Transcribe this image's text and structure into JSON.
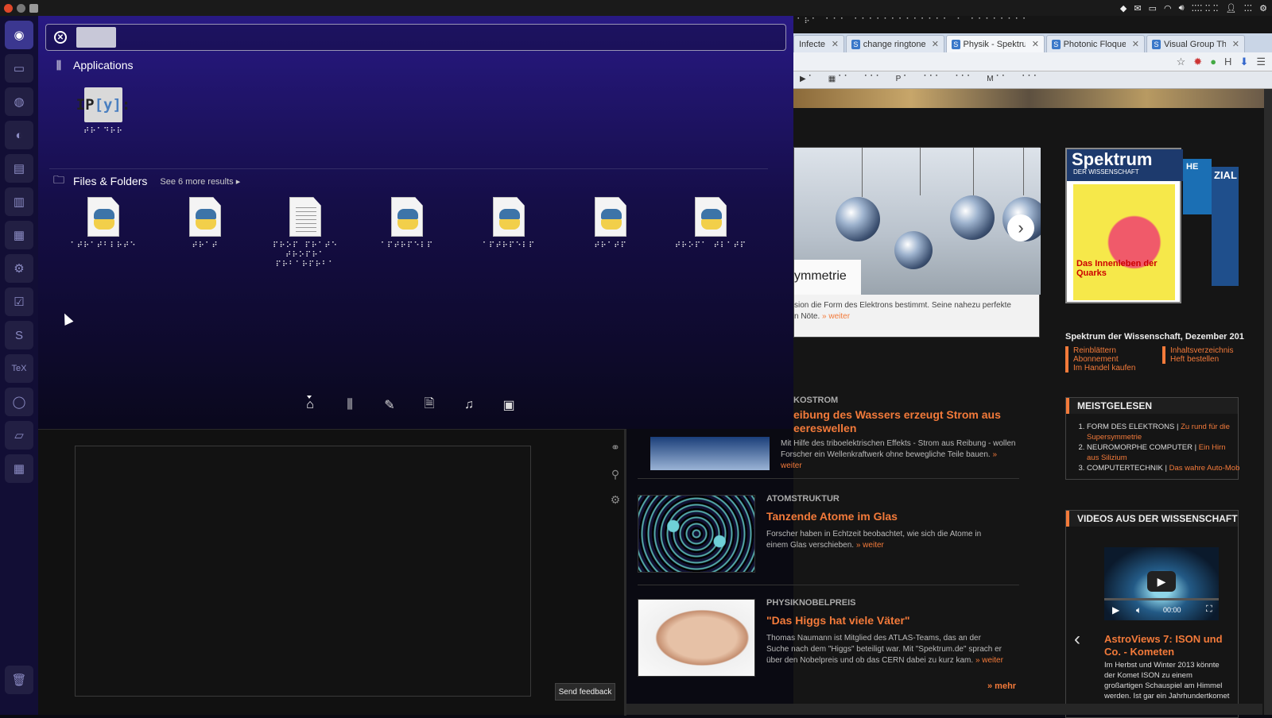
{
  "top_panel": {
    "tray_time": "⁚⁚⁚⁚ ⁚⁚ ⁚⁚",
    "tray_user": "⁚⁚⁚"
  },
  "dash": {
    "search": {
      "placeholder": ""
    },
    "applications": {
      "title": "Applications",
      "items": [
        {
          "label": "⠞⠗⠁⠙⠗⠗",
          "icon": "ipython-icon"
        }
      ]
    },
    "files": {
      "title": "Files & Folders",
      "more": "See 6 more results",
      "items": [
        {
          "label": "⠁⠞⠗⠁⠞⠃⠇⠗⠞⠑",
          "type": "python"
        },
        {
          "label": "⠞⠗⠁⠞",
          "type": "python"
        },
        {
          "label": "⠏⠗⠕⠏ ⠏⠗⠁⠞⠑ ⠞⠗⠕⠏⠗⠁ ⠏⠗⠃⠁⠗⠏⠗⠃⠁",
          "type": "text"
        },
        {
          "label": "⠁⠏⠞⠗⠏⠑⠇⠏",
          "type": "python"
        },
        {
          "label": "⠁⠏⠞⠗⠏⠑⠇⠏",
          "type": "python"
        },
        {
          "label": "⠞⠗⠁⠞⠏",
          "type": "python"
        },
        {
          "label": "⠞⠗⠕⠏⠁ ⠞⠇⠁⠞⠏",
          "type": "python"
        }
      ]
    },
    "filters": [
      "home-lens",
      "applications-lens",
      "files-lens",
      "documents-lens",
      "music-lens",
      "video-lens"
    ]
  },
  "browser": {
    "tabs": [
      {
        "label": "Infected",
        "active": false
      },
      {
        "label": "change ringtone s",
        "active": false
      },
      {
        "label": "Physik - Spektrum",
        "active": true
      },
      {
        "label": "Photonic Floquet I",
        "active": false
      },
      {
        "label": "Visual Group The",
        "active": false
      }
    ],
    "hero_caption": "ymmetrie",
    "hero_text": "sion die Form des Elektrons bestimmt. Seine nahezu perfekte",
    "hero_text2": "n Nöte.",
    "weiter": "» weiter",
    "articles": [
      {
        "kicker": "KOSTROM",
        "headline": "eibung des Wassers erzeugt Strom aus eereswellen",
        "body": "Mit Hilfe des triboelektrischen Effekts - Strom aus Reibung - wollen Forscher ein Wellenkraftwerk ohne bewegliche Teile bauen."
      },
      {
        "kicker": "ATOMSTRUKTUR",
        "headline": "Tanzende Atome im Glas",
        "body": "Forscher haben in Echtzeit beobachtet, wie sich die Atome in einem Glas verschieben."
      },
      {
        "kicker": "PHYSIKNOBELPREIS",
        "headline": "\"Das Higgs hat viele Väter\"",
        "body": "Thomas Naumann ist Mitglied des ATLAS-Teams, das an der Suche nach dem \"Higgs\" beteiligt war. Mit \"Spektrum.de\" sprach er über den Nobelpreis und ob das CERN dabei zu kurz kam."
      }
    ],
    "mehr": "» mehr",
    "magazine": {
      "title": "Spektrum",
      "subtitle": "DER WISSENSCHAFT",
      "cover_text": "Das Innenleben der Quarks",
      "caption": "Spektrum der Wissenschaft, Dezember 201",
      "links_left": [
        "Reinblättern",
        "Abonnement",
        "Im Handel kaufen"
      ],
      "links_right": [
        "Inhaltsverzeichnis",
        "Heft bestellen"
      ],
      "side_text1": "HE",
      "side_text2": "ZIAL"
    },
    "meistgelesen": {
      "title": "MEISTGELESEN",
      "items": [
        {
          "cat": "FORM DES ELEKTRONS",
          "link": "Zu rund für die Supersymmetrie"
        },
        {
          "cat": "NEUROMORPHE COMPUTER",
          "link": "Ein Hirn aus Silizium"
        },
        {
          "cat": "COMPUTERTECHNIK",
          "link": "Das wahre Auto-Mob"
        }
      ]
    },
    "videos": {
      "title": "VIDEOS AUS DER WISSENSCHAFT",
      "video_title": "AstroViews 7: ISON und Co. - Kometen",
      "video_body": "Im Herbst und Winter 2013 könnte der Komet ISON zu einem großartigen Schauspiel am Himmel werden. Ist gar ein Jahrhundertkomet zu",
      "time": "00:00"
    }
  },
  "editor": {
    "feedback_label": "Send feedback"
  }
}
